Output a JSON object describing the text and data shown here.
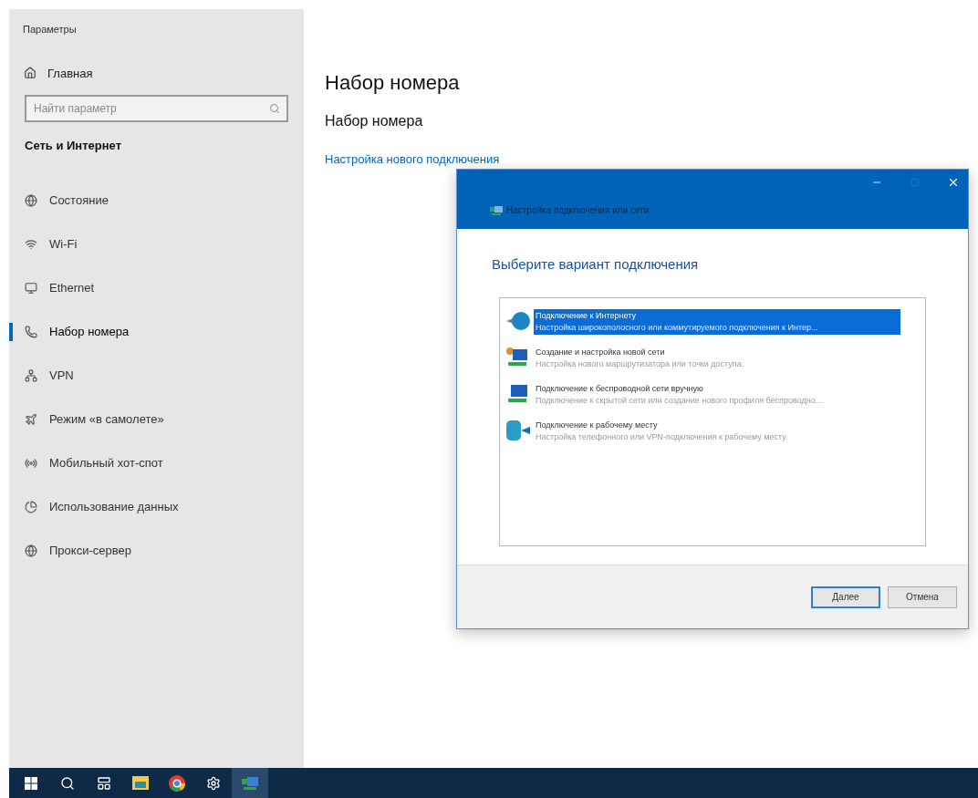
{
  "sidebar": {
    "title": "Параметры",
    "home": "Главная",
    "search": {
      "placeholder": "Найти параметр"
    },
    "section": "Сеть и Интернет",
    "items": [
      {
        "kind": "status",
        "label": "Состояние",
        "selected": false
      },
      {
        "kind": "wifi",
        "label": "Wi-Fi",
        "selected": false
      },
      {
        "kind": "ethernet",
        "label": "Ethernet",
        "selected": false
      },
      {
        "kind": "dialup",
        "label": "Набор номера",
        "selected": true
      },
      {
        "kind": "vpn",
        "label": "VPN",
        "selected": false
      },
      {
        "kind": "airplane",
        "label": "Режим «в самолете»",
        "selected": false
      },
      {
        "kind": "hotspot",
        "label": "Мобильный хот-спот",
        "selected": false
      },
      {
        "kind": "data",
        "label": "Использование данных",
        "selected": false
      },
      {
        "kind": "proxy",
        "label": "Прокси-сервер",
        "selected": false
      }
    ]
  },
  "main": {
    "heading": "Набор номера",
    "subheading": "Набор номера",
    "link": "Настройка нового подключения"
  },
  "dialog": {
    "title": "Настройка подключения или сети",
    "prompt": "Выберите вариант подключения",
    "options": [
      {
        "kind": "internet",
        "title": "Подключение к Интернету",
        "description": "Настройка широкополосного или коммутируемого подключения к Интер...",
        "selected": true
      },
      {
        "kind": "newnet",
        "title": "Создание и настройка новой сети",
        "description": "Настройка нового маршрутизатора или точки доступа.",
        "selected": false
      },
      {
        "kind": "wireless",
        "title": "Подключение к беспроводной сети вручную",
        "description": "Подключение к скрытой сети или создание нового профиля беспроводно...",
        "selected": false
      },
      {
        "kind": "workplace",
        "title": "Подключение к рабочему месту",
        "description": "Настройка телефонного или VPN-подключения к рабочему месту.",
        "selected": false
      }
    ],
    "buttons": [
      {
        "label": "Далее",
        "default": true
      },
      {
        "label": "Отмена",
        "default": false
      }
    ]
  },
  "taskbar": {
    "items": [
      {
        "kind": "start",
        "active": false
      },
      {
        "kind": "search",
        "active": false
      },
      {
        "kind": "taskview",
        "active": false
      },
      {
        "kind": "explorer",
        "active": false
      },
      {
        "kind": "browser",
        "active": false
      },
      {
        "kind": "settings",
        "active": false
      },
      {
        "kind": "network",
        "active": true
      }
    ]
  }
}
